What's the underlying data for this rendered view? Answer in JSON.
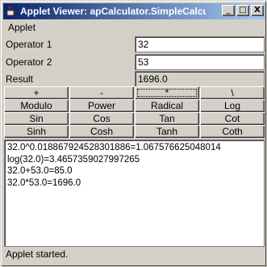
{
  "window": {
    "title": "Applet Viewer: apCalculator.SimpleCalcula..."
  },
  "title_buttons": {
    "minimize": "_",
    "maximize": "□",
    "close": "X"
  },
  "menu": {
    "applet": "Applet"
  },
  "form": {
    "operator1_label": "Operator 1",
    "operator1_value": "32",
    "operator2_label": "Operator 2",
    "operator2_value": "53",
    "result_label": "Result",
    "result_value": "1696.0"
  },
  "buttons": [
    {
      "name": "add-button",
      "label": "+"
    },
    {
      "name": "subtract-button",
      "label": "-"
    },
    {
      "name": "multiply-button",
      "label": "*",
      "focused": true
    },
    {
      "name": "divide-button",
      "label": "\\"
    },
    {
      "name": "modulo-button",
      "label": "Modulo"
    },
    {
      "name": "power-button",
      "label": "Power"
    },
    {
      "name": "radical-button",
      "label": "Radical"
    },
    {
      "name": "log-button",
      "label": "Log"
    },
    {
      "name": "sin-button",
      "label": "Sin"
    },
    {
      "name": "cos-button",
      "label": "Cos"
    },
    {
      "name": "tan-button",
      "label": "Tan"
    },
    {
      "name": "cot-button",
      "label": "Cot"
    },
    {
      "name": "sinh-button",
      "label": "Sinh"
    },
    {
      "name": "cosh-button",
      "label": "Cosh"
    },
    {
      "name": "tanh-button",
      "label": "Tanh"
    },
    {
      "name": "coth-button",
      "label": "Coth"
    }
  ],
  "output_lines": [
    "32.0^0.018867924528301886=1.067576625048014",
    "log(32.0)=3.4657359027997265",
    "32.0+53.0=85.0",
    "32.0*53.0=1696.0"
  ],
  "status": "Applet started.",
  "colors": {
    "titlebar_start": "#0a246a",
    "titlebar_end": "#a6caf0",
    "face": "#d4d0c8"
  },
  "icons": {
    "app": "java-cup-icon"
  }
}
